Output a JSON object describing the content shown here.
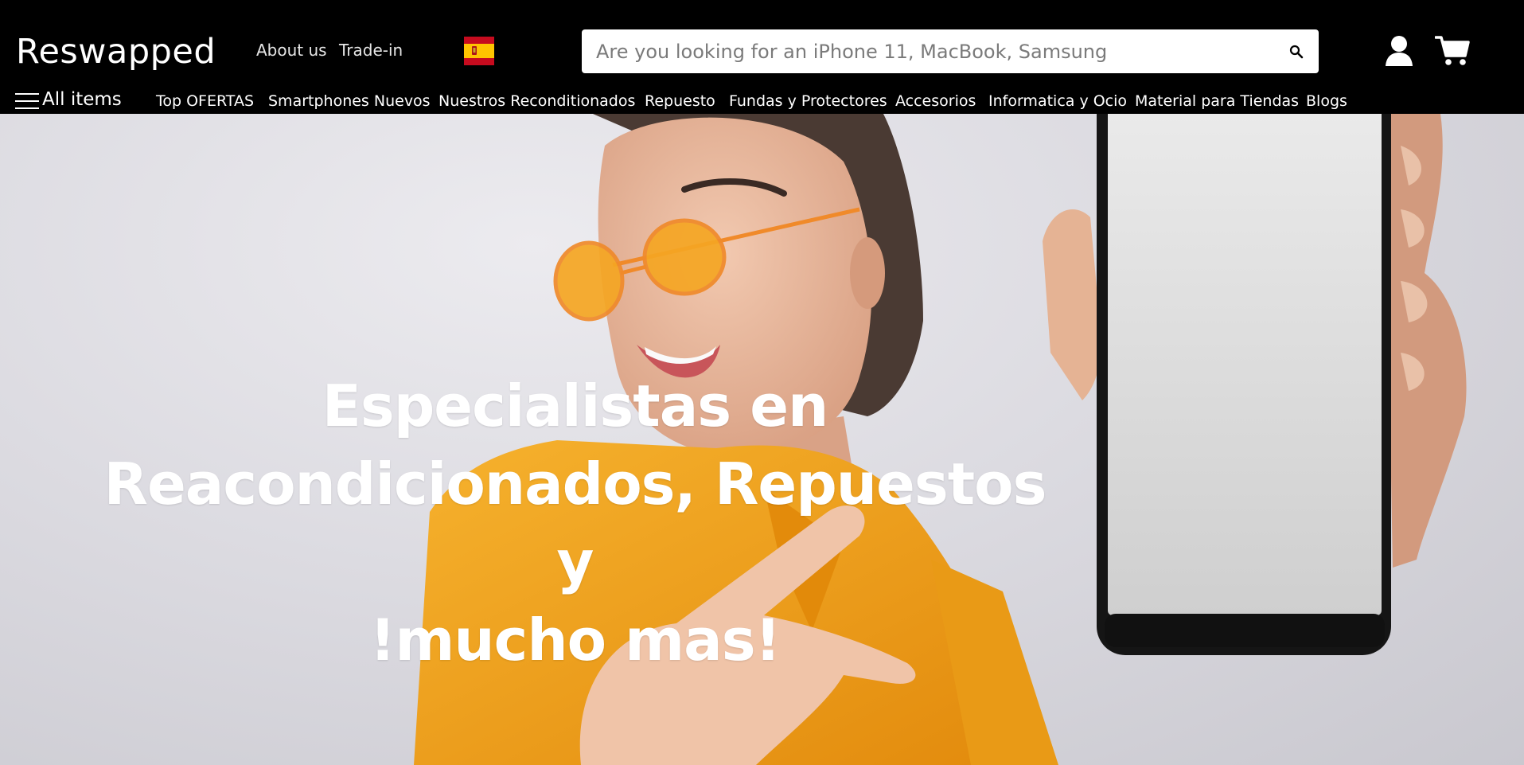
{
  "header": {
    "logo": "Reswapped",
    "links": [
      "About us",
      "Trade-in"
    ],
    "search_placeholder": "Are you looking for an iPhone 11, MacBook, Samsung"
  },
  "nav": {
    "all_items": "All items",
    "items": [
      "Top OFERTAS",
      "Smartphones Nuevos",
      "Nuestros Reconditionados",
      "Repuesto",
      "Fundas y Protectores",
      "Accesorios",
      "Informatica y Ocio",
      "Material para Tiendas",
      "Blogs"
    ]
  },
  "hero": {
    "title_lines": [
      "Especialistas en",
      "Reacondicionados, Repuestos y",
      "!mucho mas!"
    ]
  },
  "colors": {
    "header_bg": "#000000",
    "jacket": "#f0a41c",
    "glasses": "#f5a623"
  }
}
